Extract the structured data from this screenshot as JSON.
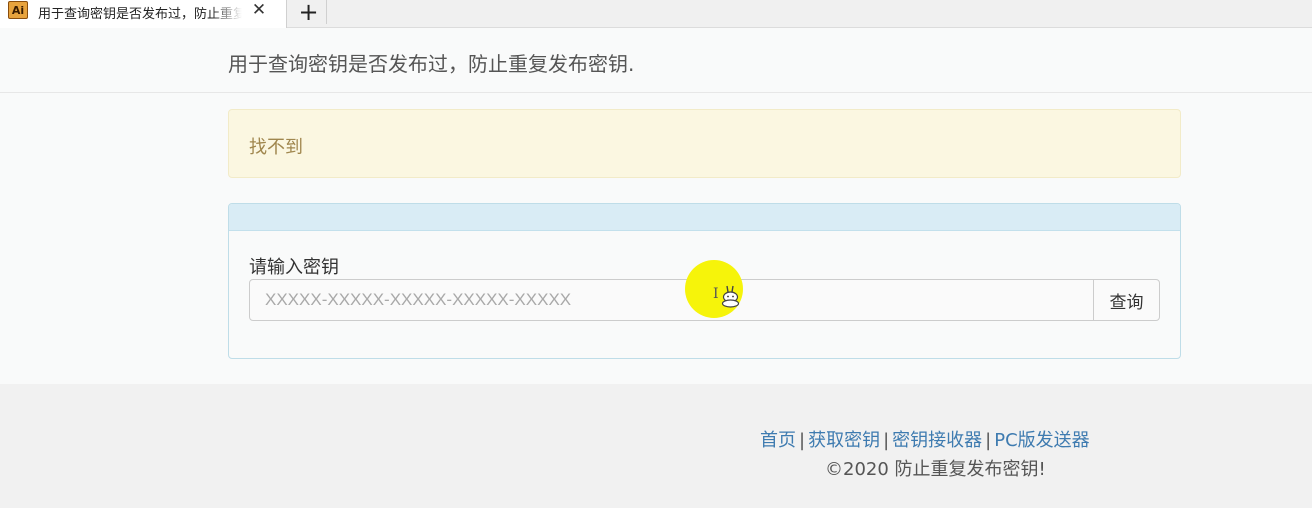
{
  "tab": {
    "favicon_text": "Ai",
    "title": "用于查询密钥是否发布过，防止重复发布密钥.",
    "close_symbol": "✕",
    "new_tab_symbol": "+"
  },
  "header": {
    "title": "用于查询密钥是否发布过，防止重复发布密钥."
  },
  "alert": {
    "message": "找不到"
  },
  "form": {
    "label": "请输入密钥",
    "input_value": "",
    "input_placeholder": "XXXXX-XXXXX-XXXXX-XXXXX-XXXXX",
    "button_label": "查询"
  },
  "overlay": {
    "text_cursor": "I"
  },
  "footer": {
    "links": [
      "首页",
      "获取密钥",
      "密钥接收器",
      "PC版发送器"
    ],
    "separator": "|",
    "copyright": "©2020 防止重复发布密钥!"
  },
  "colors": {
    "link": "#3e7bb0",
    "alert_bg": "#fbf7e1",
    "alert_text": "#a0874e",
    "panel_heading_bg": "#d9ecf5",
    "cursor_highlight": "#f6f40a"
  },
  "icons": {
    "favicon": "illustrator-app-icon",
    "close": "close-icon",
    "new_tab": "plus-icon",
    "cursor": "text-cursor-icon",
    "mascot": "rabbit-mascot-icon"
  }
}
